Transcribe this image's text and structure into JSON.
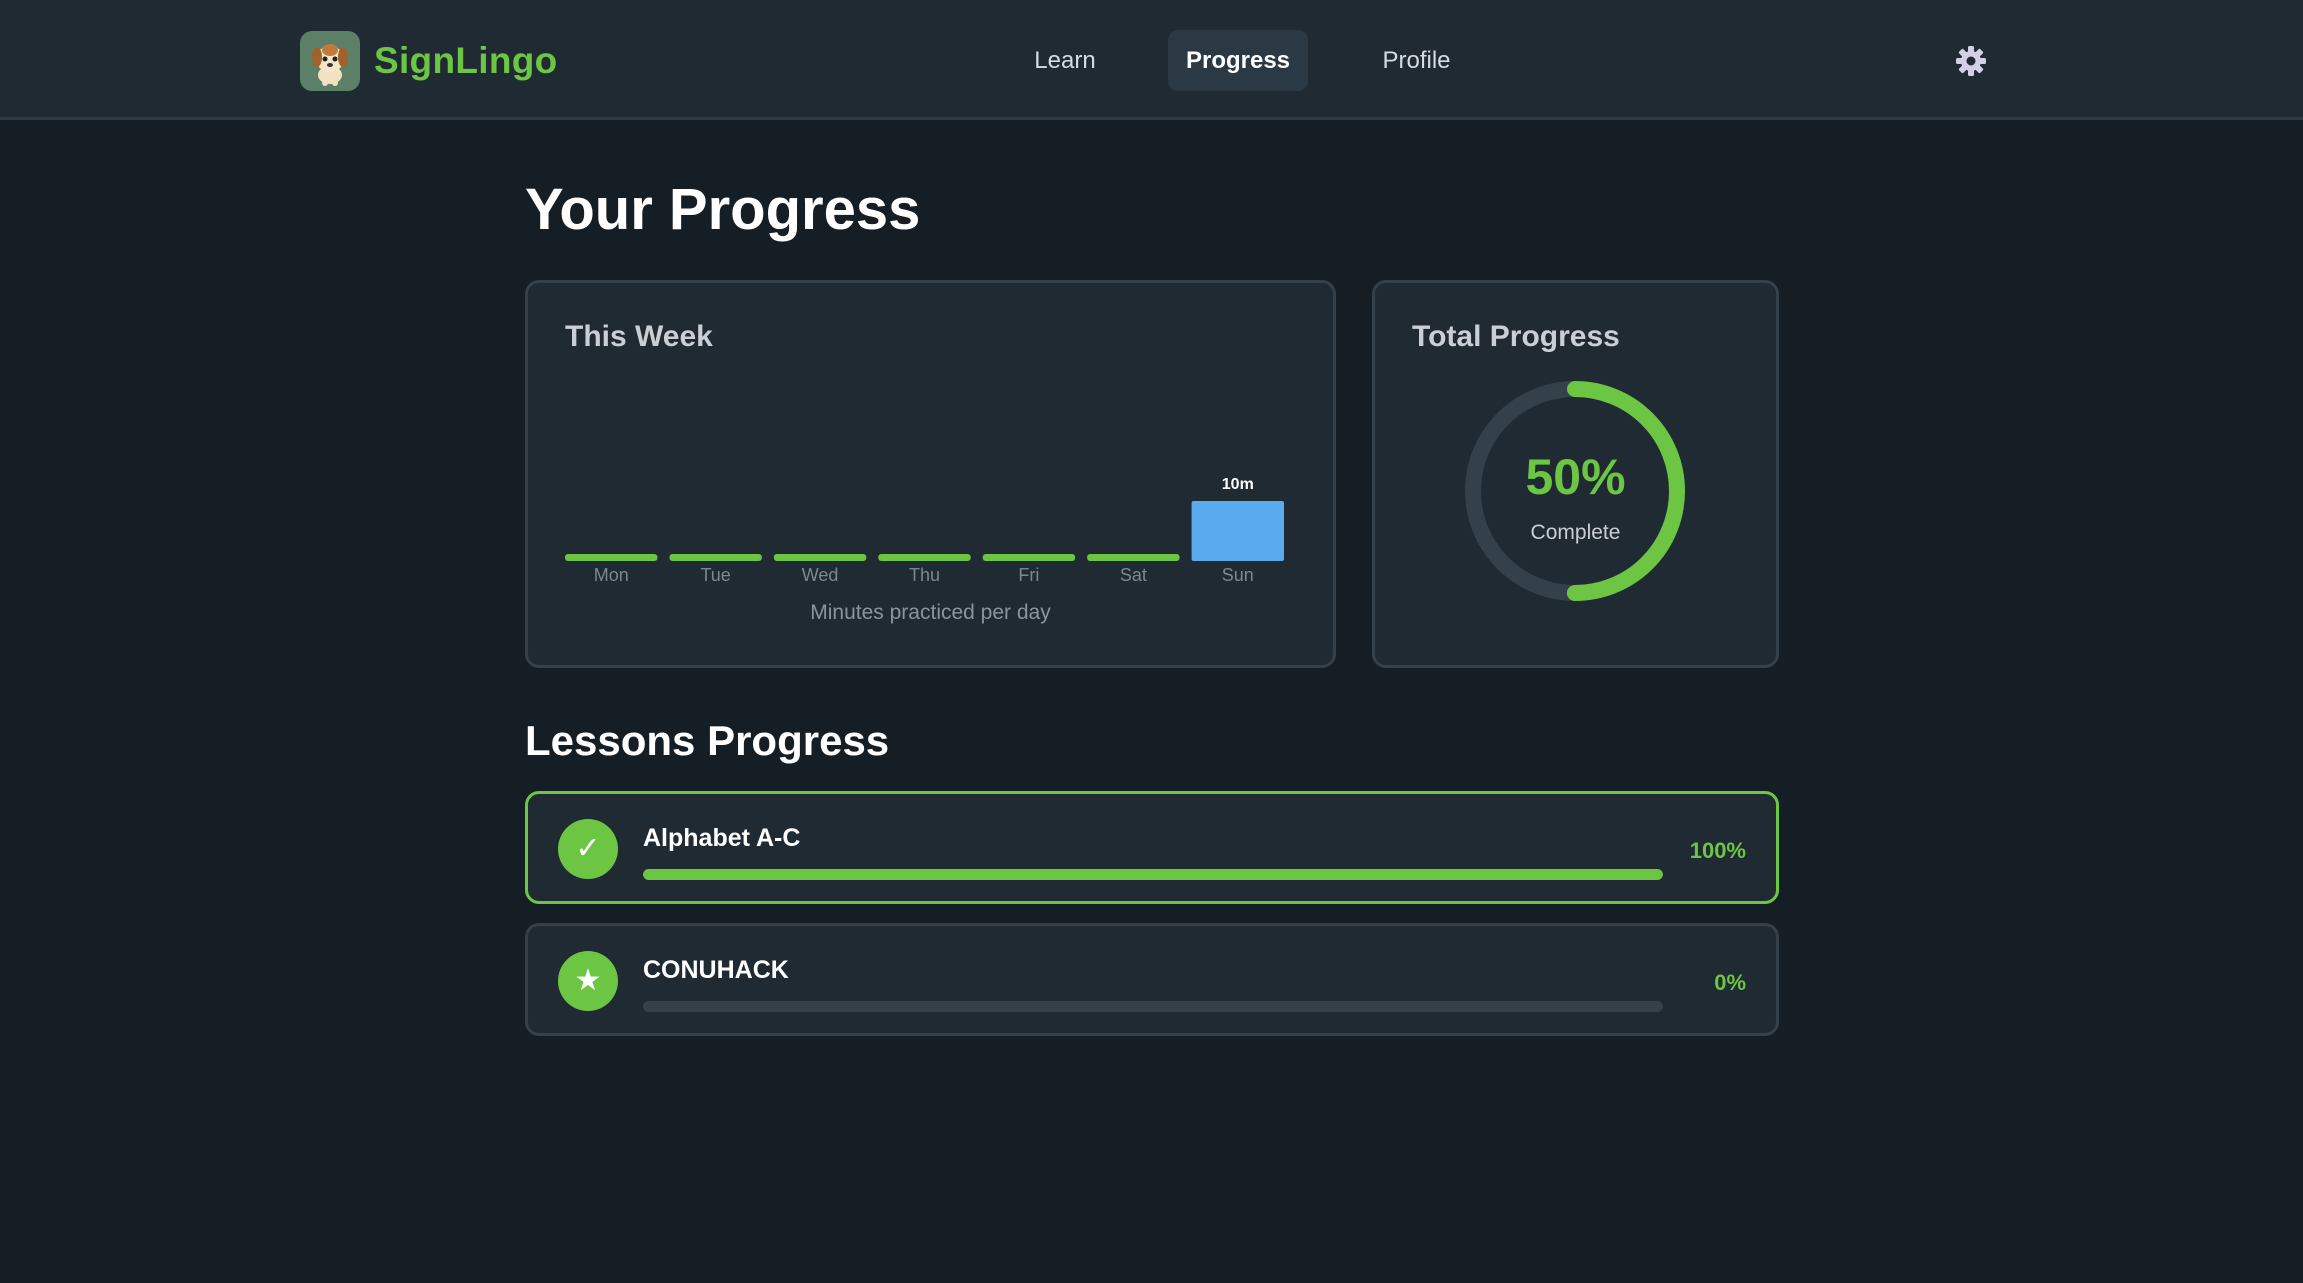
{
  "app": {
    "name": "SignLingo"
  },
  "nav": {
    "tabs": [
      {
        "label": "Learn",
        "active": false
      },
      {
        "label": "Progress",
        "active": true
      },
      {
        "label": "Profile",
        "active": false
      }
    ]
  },
  "page": {
    "title": "Your Progress"
  },
  "week_card": {
    "title": "This Week"
  },
  "total_card": {
    "title": "Total Progress",
    "value_label": "50%",
    "value_fraction": 0.5,
    "sub_label": "Complete"
  },
  "lessons_section": {
    "title": "Lessons Progress",
    "lessons": [
      {
        "name": "Alphabet A-C",
        "percent_label": "100%",
        "fraction": 1.0,
        "icon": "check-icon",
        "icon_glyph": "✓",
        "completed": true
      },
      {
        "name": "CONUHACK",
        "percent_label": "0%",
        "fraction": 0.0,
        "icon": "star-icon",
        "icon_glyph": "★",
        "completed": false
      }
    ]
  },
  "colors": {
    "accent_green": "#6cc644",
    "highlight_blue": "#5aaaf0",
    "background": "#161e25",
    "card": "#1f2a32",
    "border": "#34404a"
  },
  "chart_data": {
    "type": "bar",
    "categories": [
      "Mon",
      "Tue",
      "Wed",
      "Thu",
      "Fri",
      "Sat",
      "Sun"
    ],
    "values": [
      0,
      0,
      0,
      0,
      0,
      0,
      10
    ],
    "value_labels": [
      "",
      "",
      "",
      "",
      "",
      "",
      "10m"
    ],
    "xlabel": "Minutes practiced per day",
    "ylabel": "",
    "highlight_category": "Sun",
    "grid": false
  }
}
